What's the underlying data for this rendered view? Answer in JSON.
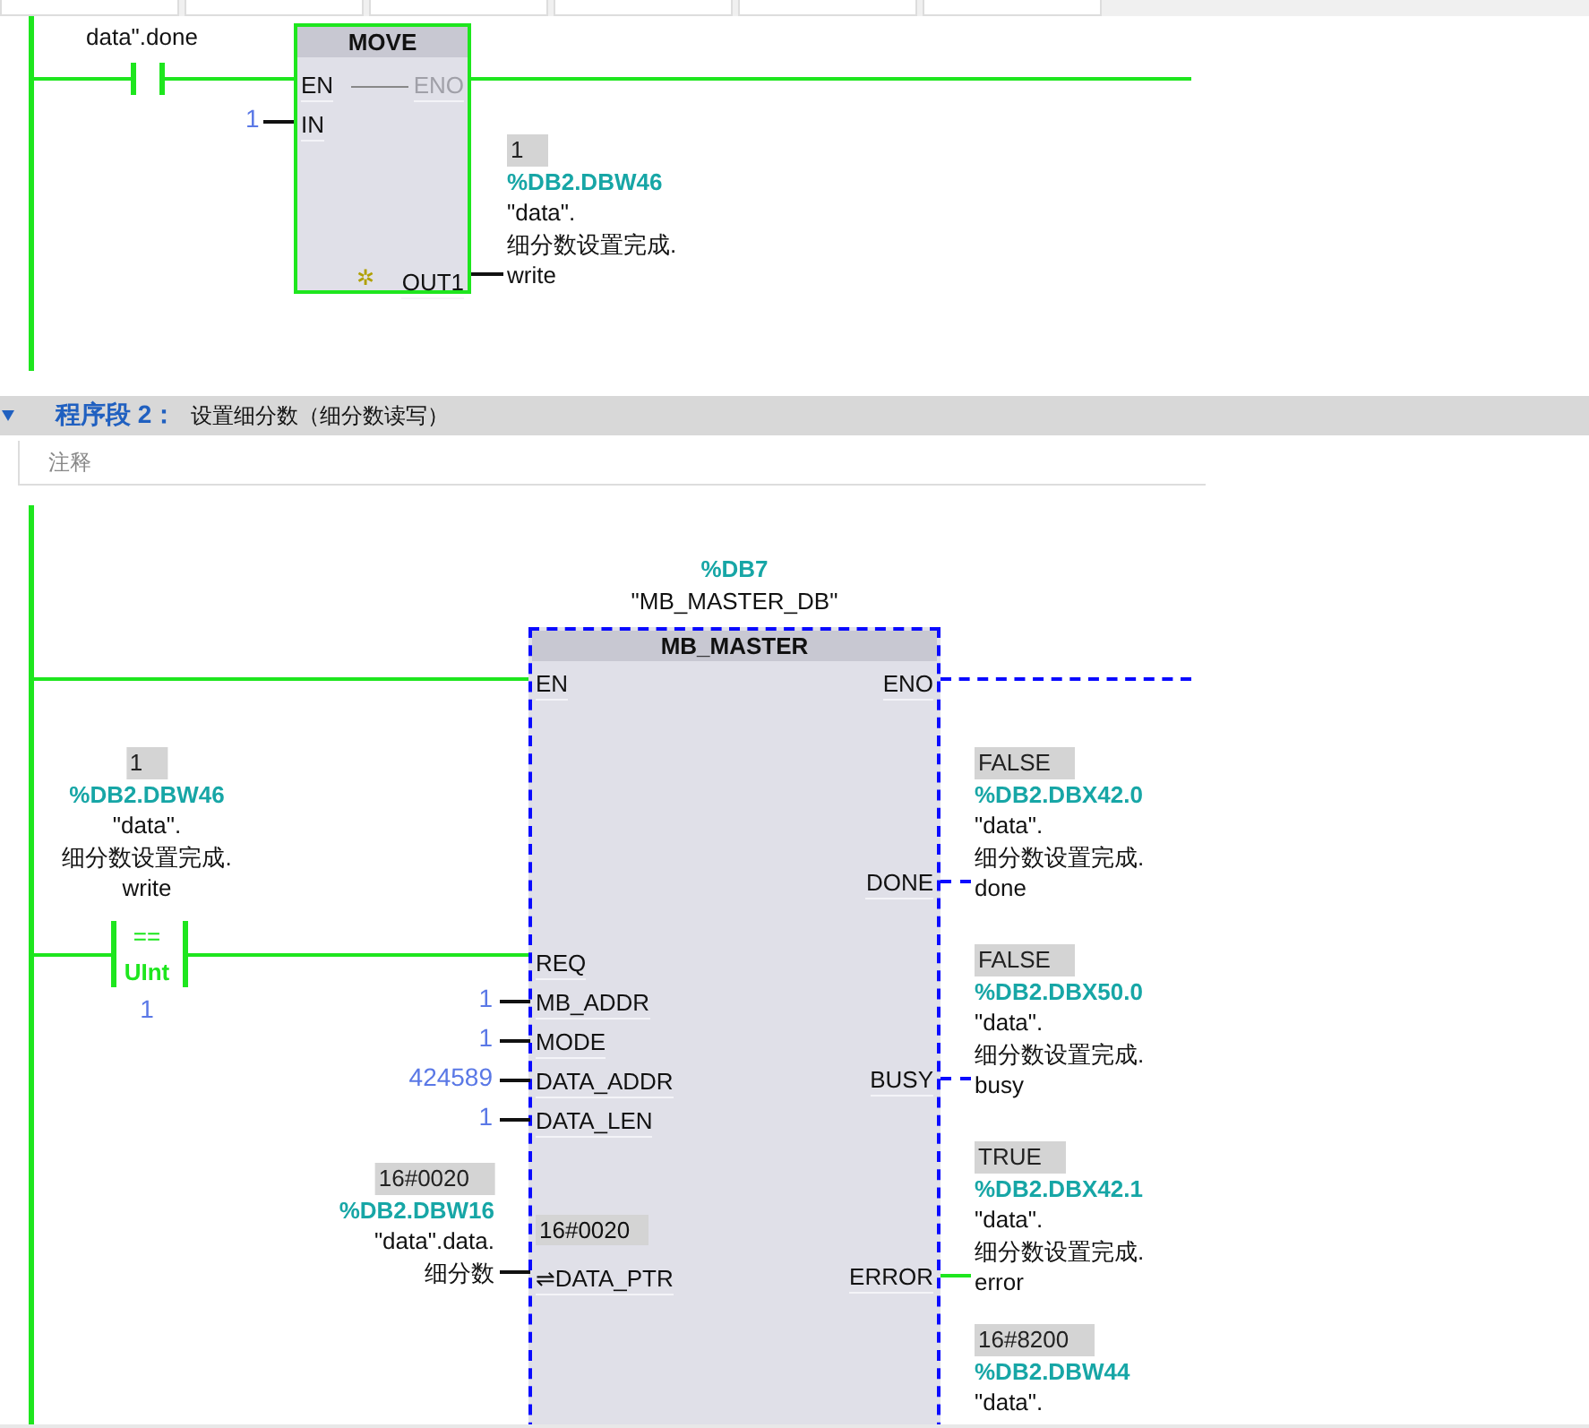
{
  "network_1": {
    "contact": {
      "label": "data\".done",
      "energized": true
    },
    "block": {
      "title": "MOVE",
      "energized": true,
      "en": "EN",
      "eno": "ENO",
      "input": {
        "pin": "IN",
        "value": "1"
      },
      "output": {
        "pin": "OUT1",
        "marker": "✲",
        "value": "1",
        "address": "%DB2.DBW46",
        "symbol": [
          "\"data\".",
          "细分数设置完成.",
          "write"
        ]
      }
    }
  },
  "network_2": {
    "header": {
      "title": "程序段 2：",
      "description": "设置细分数（细分数读写）",
      "expanded": true
    },
    "comment": {
      "placeholder": "注释"
    },
    "instance": {
      "address": "%DB7",
      "name": "\"MB_MASTER_DB\""
    },
    "compare": {
      "value": "1",
      "address": "%DB2.DBW46",
      "symbol": [
        "\"data\".",
        "细分数设置完成.",
        "write"
      ],
      "operator": "==",
      "type": "UInt",
      "operand": "1",
      "energized": true
    },
    "block": {
      "title": "MB_MASTER",
      "energized": false,
      "en": "EN",
      "eno": "ENO",
      "inputs": [
        {
          "pin": "REQ",
          "kind": "wire"
        },
        {
          "pin": "MB_ADDR",
          "kind": "constant",
          "value": "1"
        },
        {
          "pin": "MODE",
          "kind": "constant",
          "value": "1"
        },
        {
          "pin": "DATA_ADDR",
          "kind": "constant",
          "value": "424589"
        },
        {
          "pin": "DATA_LEN",
          "kind": "constant",
          "value": "1"
        },
        {
          "pin": "DATA_PTR",
          "kind": "inout",
          "marker": "⇌",
          "pin_value": "16#0020",
          "value": "16#0020",
          "address": "%DB2.DBW16",
          "symbol": [
            "\"data\".data.",
            "细分数"
          ]
        }
      ],
      "outputs": [
        {
          "pin": "DONE",
          "energized": false,
          "value": "FALSE",
          "address": "%DB2.DBX42.0",
          "symbol": [
            "\"data\".",
            "细分数设置完成.",
            "done"
          ]
        },
        {
          "pin": "BUSY",
          "energized": false,
          "value": "FALSE",
          "address": "%DB2.DBX50.0",
          "symbol": [
            "\"data\".",
            "细分数设置完成.",
            "busy"
          ]
        },
        {
          "pin": "ERROR",
          "energized": true,
          "value": "TRUE",
          "address": "%DB2.DBX42.1",
          "symbol": [
            "\"data\".",
            "细分数设置完成.",
            "error"
          ]
        },
        {
          "value": "16#8200",
          "address": "%DB2.DBW44",
          "symbol": [
            "\"data\"."
          ]
        }
      ]
    }
  }
}
